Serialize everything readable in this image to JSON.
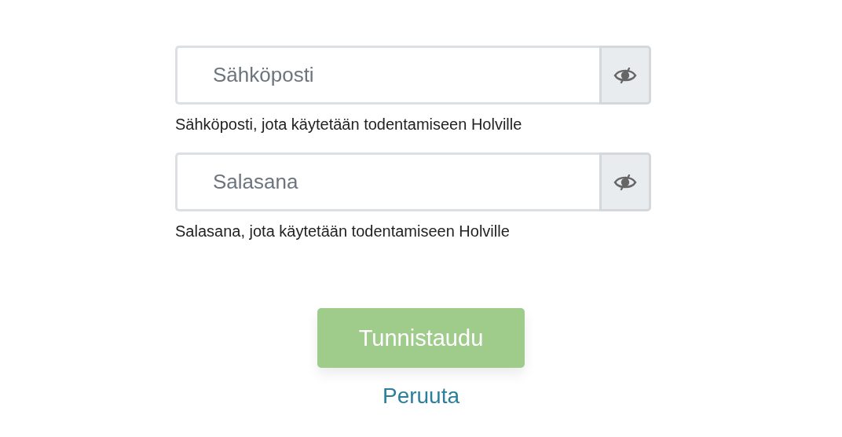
{
  "fields": [
    {
      "placeholder": "Sähköposti",
      "help": "Sähköposti, jota käytetään todentamiseen Holville"
    },
    {
      "placeholder": "Salasana",
      "help": "Salasana, jota käytetään todentamiseen Holville"
    }
  ],
  "submit": {
    "label": "Tunnistaudu",
    "disabled": true
  },
  "cancel": {
    "label": "Peruuta"
  }
}
